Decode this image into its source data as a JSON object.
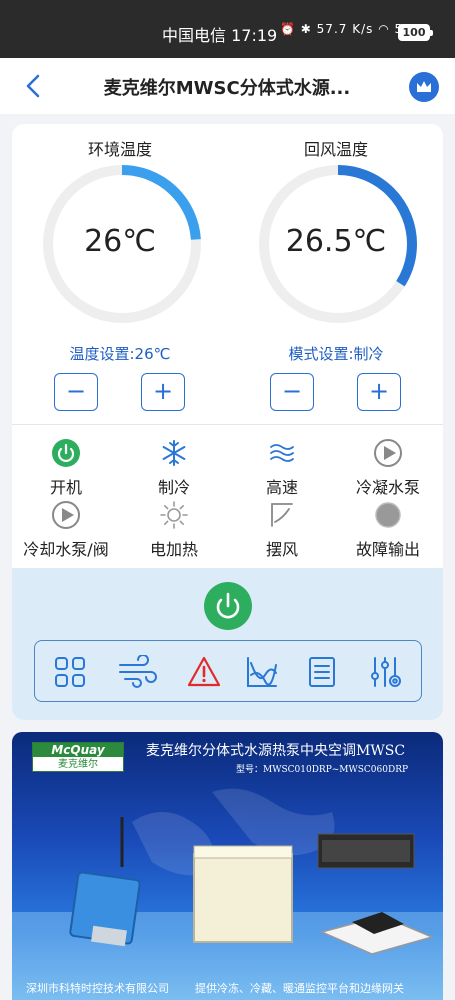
{
  "status_bar": {
    "carrier_time": "中国电信 17:19",
    "network_speed": "57.7 K/s",
    "signal": "5G",
    "battery": "100"
  },
  "header": {
    "title": "麦克维尔MWSC分体式水源..."
  },
  "gauges": [
    {
      "label": "环境温度",
      "value": "26℃",
      "fill": 0.24,
      "setting": "温度设置:26℃"
    },
    {
      "label": "回风温度",
      "value": "26.5℃",
      "fill": 0.34,
      "setting": "模式设置:制冷"
    }
  ],
  "buttons": {
    "minus": "−",
    "plus": "+"
  },
  "functions": [
    {
      "label": "开机",
      "icon": "power-on-icon"
    },
    {
      "label": "制冷",
      "icon": "snowflake-icon"
    },
    {
      "label": "高速",
      "icon": "wind-speed-icon"
    },
    {
      "label": "冷凝水泵",
      "icon": "play-icon"
    },
    {
      "label": "冷却水泵/阀",
      "icon": "play-icon"
    },
    {
      "label": "电加热",
      "icon": "sun-icon"
    },
    {
      "label": "摆风",
      "icon": "swing-icon"
    },
    {
      "label": "故障输出",
      "icon": "fault-dot-icon"
    }
  ],
  "toolbar": [
    "grid-icon",
    "wind-icon",
    "warning-icon",
    "chart-icon",
    "list-icon",
    "settings-sliders-icon"
  ],
  "banner": {
    "logo": "McQuay",
    "logo_cn": "麦克维尔",
    "title": "麦克维尔分体式水源热泵中央空调MWSC",
    "subtitle": "型号：MWSC010DRP~MWSC060DRP",
    "footer_left": "深圳市科特时控技术有限公司",
    "footer_right": "提供冷冻、冷藏、暖通监控平台和边缘网关"
  },
  "colors": {
    "accent": "#2a6fd6",
    "gauge_track": "#eeeeee",
    "power_green": "#2cae5e",
    "panel_bg": "#dcebf8"
  }
}
